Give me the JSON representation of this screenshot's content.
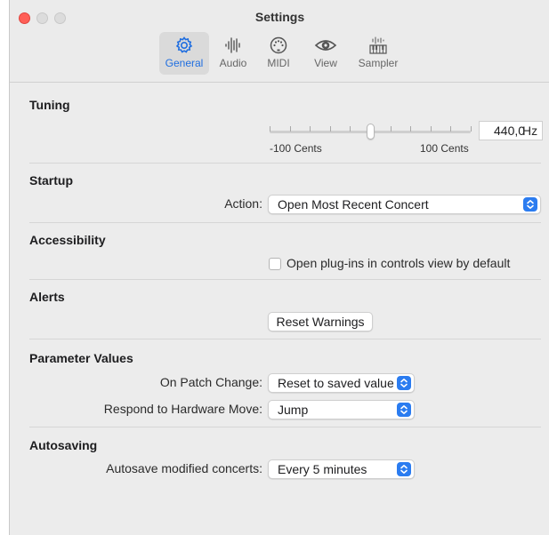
{
  "window": {
    "title": "Settings",
    "tabs": [
      {
        "label": "General",
        "icon": "gear-icon",
        "active": true
      },
      {
        "label": "Audio",
        "icon": "waveform-icon",
        "active": false
      },
      {
        "label": "MIDI",
        "icon": "midi-connector-icon",
        "active": false
      },
      {
        "label": "View",
        "icon": "eye-icon",
        "active": false
      },
      {
        "label": "Sampler",
        "icon": "sampler-icon",
        "active": false
      }
    ]
  },
  "tuning": {
    "title": "Tuning",
    "min_label": "-100 Cents",
    "max_label": "100 Cents",
    "value": "440,0",
    "unit": "Hz",
    "slider_fraction": 0.5
  },
  "startup": {
    "title": "Startup",
    "action_label": "Action:",
    "action_value": "Open Most Recent Concert"
  },
  "accessibility": {
    "title": "Accessibility",
    "checkbox_label": "Open plug-ins in controls view by default",
    "checked": false
  },
  "alerts": {
    "title": "Alerts",
    "reset_button": "Reset Warnings"
  },
  "parameter_values": {
    "title": "Parameter Values",
    "patch_change_label": "On Patch Change:",
    "patch_change_value": "Reset to saved value",
    "hardware_move_label": "Respond to Hardware Move:",
    "hardware_move_value": "Jump"
  },
  "autosaving": {
    "title": "Autosaving",
    "autosave_label": "Autosave modified concerts:",
    "autosave_value": "Every 5 minutes"
  },
  "colors": {
    "accent": "#1f6ee0",
    "close": "#ff5f57"
  }
}
